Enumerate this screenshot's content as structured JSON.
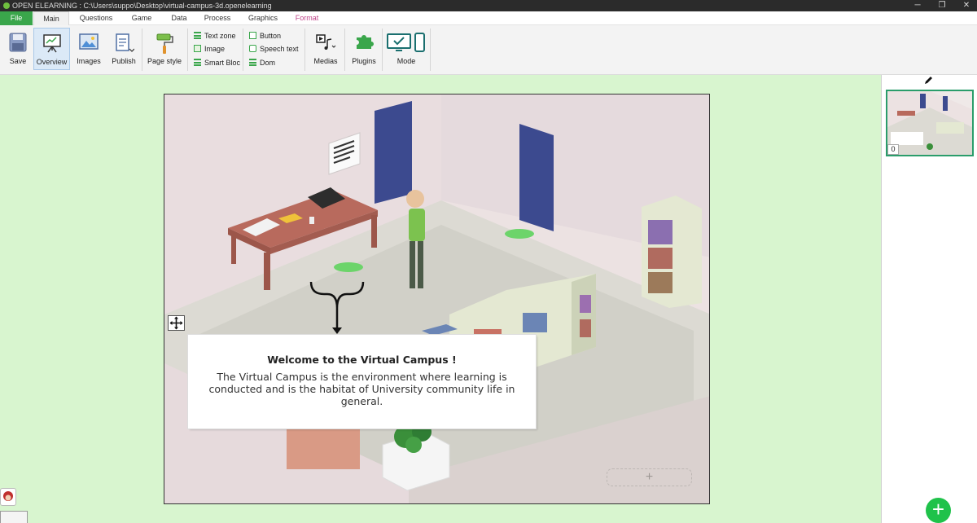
{
  "window": {
    "title": "OPEN ELEARNING : C:\\Users\\suppo\\Desktop\\virtual-campus-3d.openelearning",
    "minimize": "─",
    "maximize": "❐",
    "close": "✕"
  },
  "menu": {
    "tabs": [
      "File",
      "Main",
      "Questions",
      "Game",
      "Data",
      "Process",
      "Graphics",
      "Format"
    ],
    "active": "Main"
  },
  "ribbon": {
    "save": "Save",
    "overview": "Overview",
    "images": "Images",
    "publish": "Publish",
    "page_style": "Page style",
    "text_zone": "Text zone",
    "image": "Image",
    "smart_bloc": "Smart Bloc",
    "button": "Button",
    "speech_text": "Speech text",
    "dom": "Dom",
    "medias": "Medias",
    "plugins": "Plugins",
    "mode": "Mode"
  },
  "slide": {
    "title": "Welcome to the Virtual Campus !",
    "body": "The Virtual Campus is the environment where learning is conducted and is the habitat of University community life in general.",
    "add_symbol": "+"
  },
  "pages": {
    "thumbnail_index": "0"
  },
  "add_page_symbol": "+",
  "colors": {
    "workspace": "#d8f5cf",
    "file_tab": "#3aa64b",
    "format_tab": "#c0458a",
    "thumbnail_border": "#2a9d6b",
    "fab": "#1fc24a"
  }
}
